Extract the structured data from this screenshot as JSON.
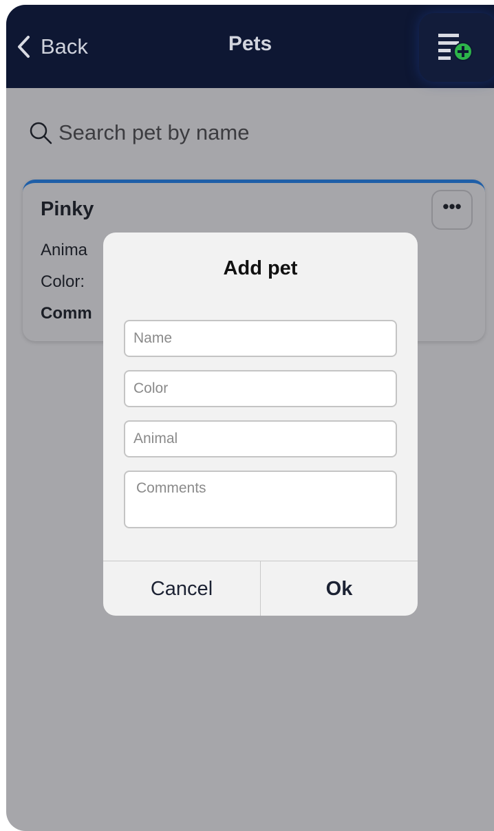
{
  "navbar": {
    "back_label": "Back",
    "title": "Pets",
    "add_icon": "playlist-add-icon",
    "background": "#0e1733",
    "add_icon_accent": "#2db34a"
  },
  "search": {
    "icon": "search-icon",
    "placeholder": "Search pet by name",
    "value": ""
  },
  "pet_card": {
    "name": "Pinky",
    "animal_label": "Anima",
    "color_label": "Color:",
    "comments_label": "Comm",
    "more_label": "•••",
    "accent": "#1f5fa8"
  },
  "dialog": {
    "title": "Add pet",
    "fields": {
      "name_placeholder": "Name",
      "color_placeholder": "Color",
      "animal_placeholder": "Animal",
      "comments_placeholder": "Comments"
    },
    "cancel_label": "Cancel",
    "ok_label": "Ok"
  }
}
